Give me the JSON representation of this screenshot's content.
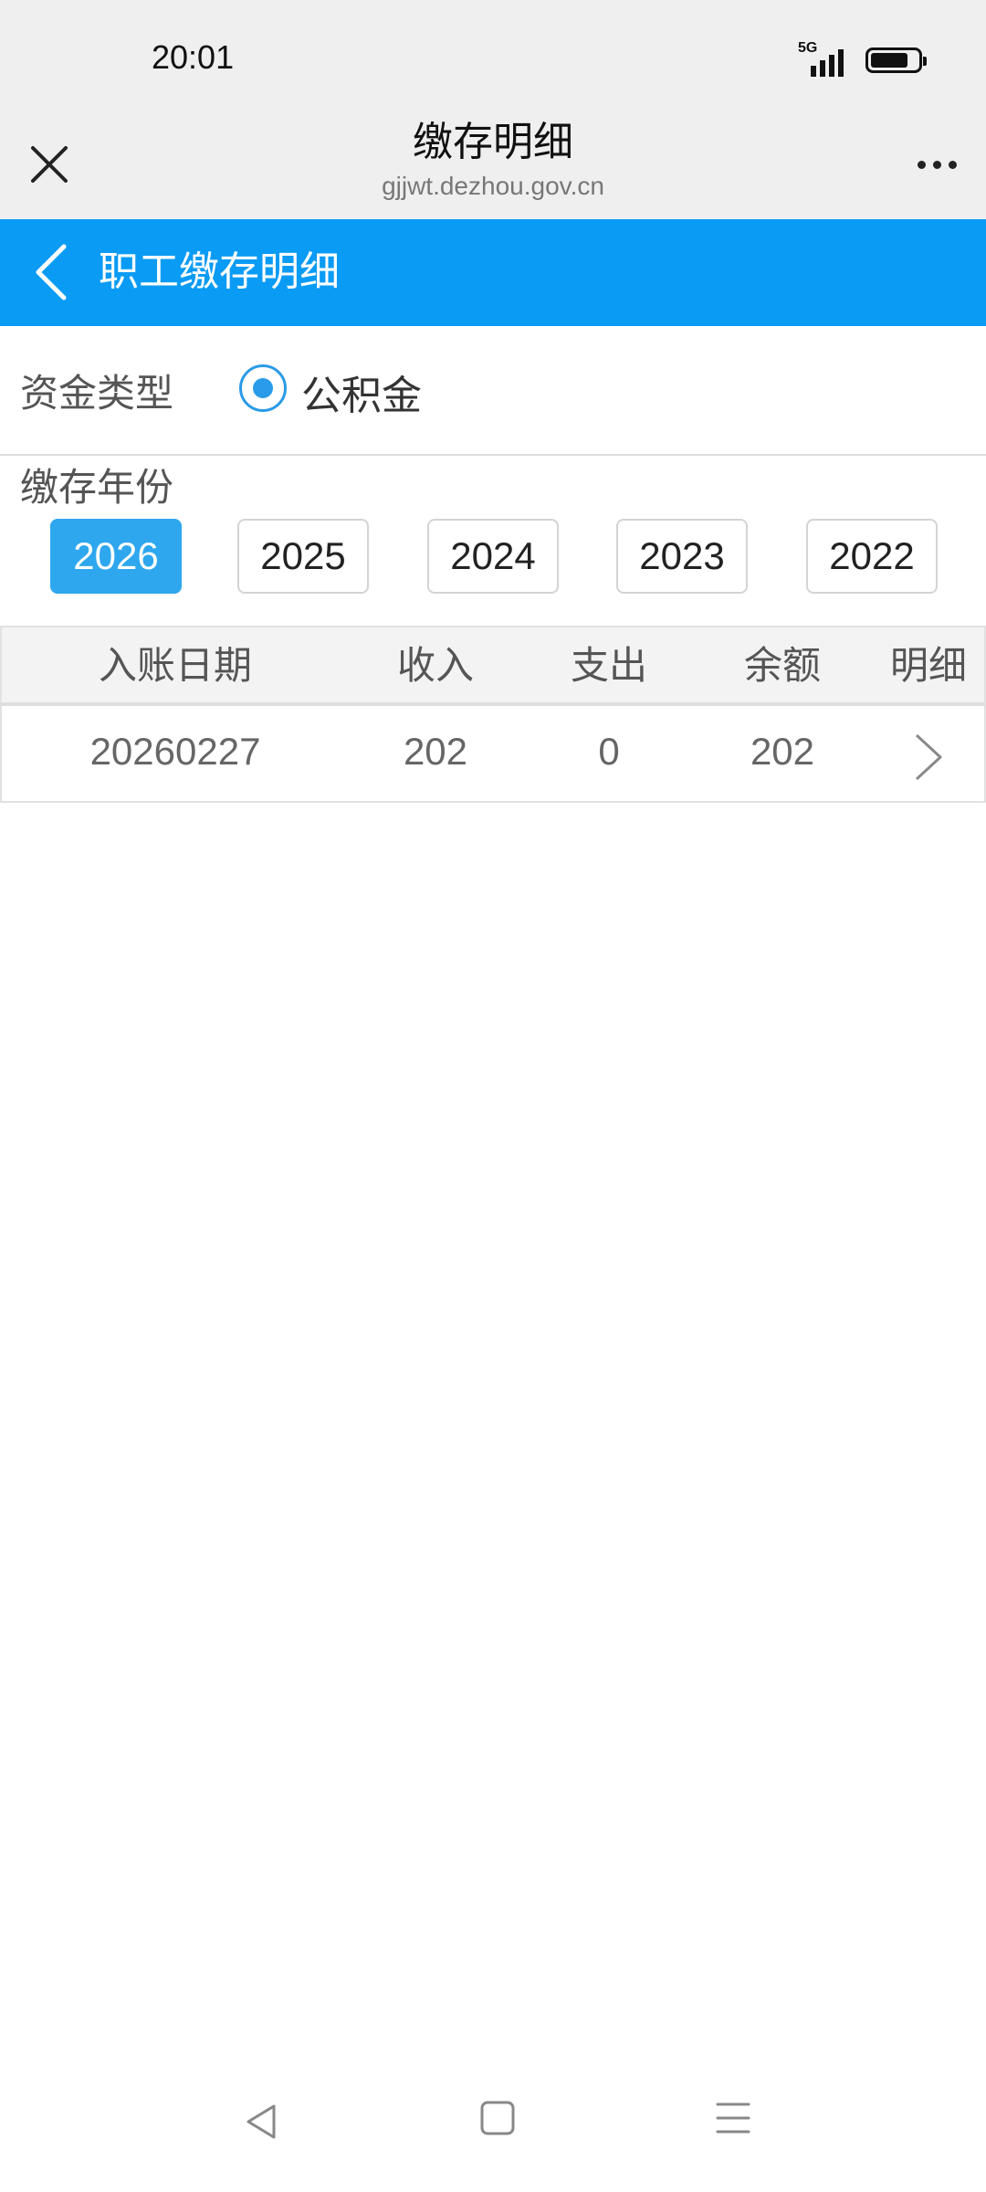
{
  "status_bar": {
    "time": "20:01",
    "network": "5G",
    "battery_level": 0.8
  },
  "browser": {
    "title": "缴存明细",
    "url": "gjjwt.dezhou.gov.cn"
  },
  "header": {
    "title": "职工缴存明细"
  },
  "fund_type": {
    "label": "资金类型",
    "selected_option": "公积金"
  },
  "year_section": {
    "label": "缴存年份",
    "years": [
      "2026",
      "2025",
      "2024",
      "2023",
      "2022"
    ],
    "selected": "2026"
  },
  "table": {
    "headers": [
      "入账日期",
      "收入",
      "支出",
      "余额",
      "明细"
    ],
    "rows": [
      {
        "date": "20260227",
        "income": "202",
        "expense": "0",
        "balance": "202"
      }
    ]
  },
  "colors": {
    "header_bg": "#0a9bf5",
    "selected_year_bg": "#2ea7ee",
    "radio": "#2a9be8"
  }
}
